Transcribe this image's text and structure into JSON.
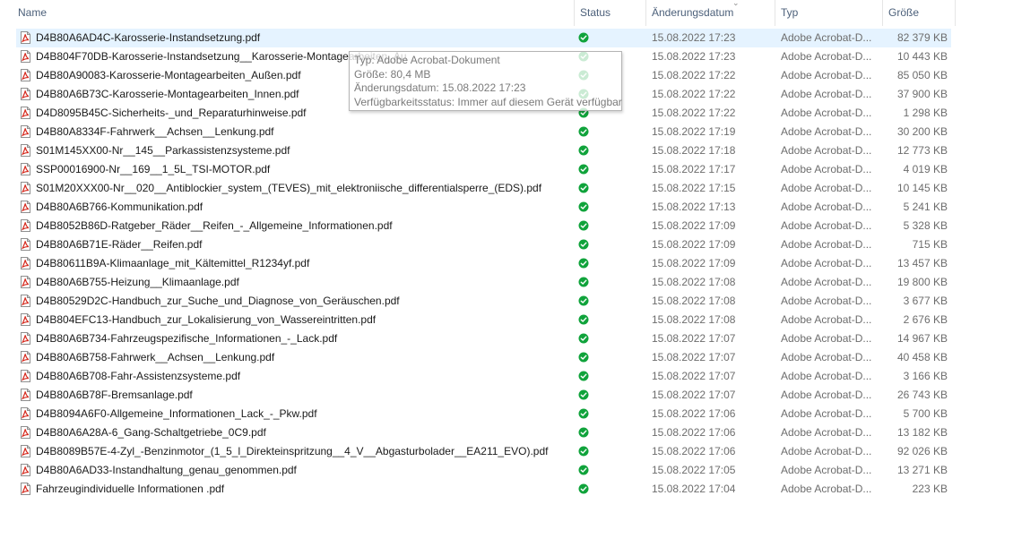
{
  "columns": {
    "name": "Name",
    "status": "Status",
    "date": "Änderungsdatum",
    "type": "Typ",
    "size": "Größe"
  },
  "icons": {
    "file": "pdf-file-icon",
    "status": "available-check-icon",
    "sort": "sort-chevron-icon",
    "pdf_color": "#d62b1f",
    "status_color": "#10a33b"
  },
  "files": [
    {
      "name": "D4B80A6AD4C-Karosserie-Instandsetzung.pdf",
      "date": "15.08.2022 17:23",
      "type": "Adobe Acrobat-D...",
      "size": "82 379 KB",
      "selected": true
    },
    {
      "name": "D4B804F70DB-Karosserie-Instandsetzung__Karosserie-Montagearbeiten_Au",
      "date": "15.08.2022 17:23",
      "type": "Adobe Acrobat-D...",
      "size": "10 443 KB"
    },
    {
      "name": "D4B80A90083-Karosserie-Montagearbeiten_Außen.pdf",
      "date": "15.08.2022 17:22",
      "type": "Adobe Acrobat-D...",
      "size": "85 050 KB"
    },
    {
      "name": "D4B80A6B73C-Karosserie-Montagearbeiten_Innen.pdf",
      "date": "15.08.2022 17:22",
      "type": "Adobe Acrobat-D...",
      "size": "37 900 KB"
    },
    {
      "name": "D4D8095B45C-Sicherheits-_und_Reparaturhinweise.pdf",
      "date": "15.08.2022 17:22",
      "type": "Adobe Acrobat-D...",
      "size": "1 298 KB"
    },
    {
      "name": "D4B80A8334F-Fahrwerk__Achsen__Lenkung.pdf",
      "date": "15.08.2022 17:19",
      "type": "Adobe Acrobat-D...",
      "size": "30 200 KB"
    },
    {
      "name": "S01M145XX00-Nr__145__Parkassistenzsysteme.pdf",
      "date": "15.08.2022 17:18",
      "type": "Adobe Acrobat-D...",
      "size": "12 773 KB"
    },
    {
      "name": "SSP00016900-Nr__169__1_5L_TSI-MOTOR.pdf",
      "date": "15.08.2022 17:17",
      "type": "Adobe Acrobat-D...",
      "size": "4 019 KB"
    },
    {
      "name": "S01M20XXX00-Nr__020__Antiblockier_system_(TEVES)_mit_elektroniische_differentialsperre_(EDS).pdf",
      "date": "15.08.2022 17:15",
      "type": "Adobe Acrobat-D...",
      "size": "10 145 KB"
    },
    {
      "name": "D4B80A6B766-Kommunikation.pdf",
      "date": "15.08.2022 17:13",
      "type": "Adobe Acrobat-D...",
      "size": "5 241 KB"
    },
    {
      "name": "D4B8052B86D-Ratgeber_Räder__Reifen_-_Allgemeine_Informationen.pdf",
      "date": "15.08.2022 17:09",
      "type": "Adobe Acrobat-D...",
      "size": "5 328 KB"
    },
    {
      "name": "D4B80A6B71E-Räder__Reifen.pdf",
      "date": "15.08.2022 17:09",
      "type": "Adobe Acrobat-D...",
      "size": "715 KB"
    },
    {
      "name": "D4B80611B9A-Klimaanlage_mit_Kältemittel_R1234yf.pdf",
      "date": "15.08.2022 17:09",
      "type": "Adobe Acrobat-D...",
      "size": "13 457 KB"
    },
    {
      "name": "D4B80A6B755-Heizung__Klimaanlage.pdf",
      "date": "15.08.2022 17:08",
      "type": "Adobe Acrobat-D...",
      "size": "19 800 KB"
    },
    {
      "name": "D4B80529D2C-Handbuch_zur_Suche_und_Diagnose_von_Geräuschen.pdf",
      "date": "15.08.2022 17:08",
      "type": "Adobe Acrobat-D...",
      "size": "3 677 KB"
    },
    {
      "name": "D4B804EFC13-Handbuch_zur_Lokalisierung_von_Wassereintritten.pdf",
      "date": "15.08.2022 17:08",
      "type": "Adobe Acrobat-D...",
      "size": "2 676 KB"
    },
    {
      "name": "D4B80A6B734-Fahrzeugspezifische_Informationen_-_Lack.pdf",
      "date": "15.08.2022 17:07",
      "type": "Adobe Acrobat-D...",
      "size": "14 967 KB"
    },
    {
      "name": "D4B80A6B758-Fahrwerk__Achsen__Lenkung.pdf",
      "date": "15.08.2022 17:07",
      "type": "Adobe Acrobat-D...",
      "size": "40 458 KB"
    },
    {
      "name": "D4B80A6B708-Fahr-Assistenzsysteme.pdf",
      "date": "15.08.2022 17:07",
      "type": "Adobe Acrobat-D...",
      "size": "3 166 KB"
    },
    {
      "name": "D4B80A6B78F-Bremsanlage.pdf",
      "date": "15.08.2022 17:07",
      "type": "Adobe Acrobat-D...",
      "size": "26 743 KB"
    },
    {
      "name": "D4B8094A6F0-Allgemeine_Informationen_Lack_-_Pkw.pdf",
      "date": "15.08.2022 17:06",
      "type": "Adobe Acrobat-D...",
      "size": "5 700 KB"
    },
    {
      "name": "D4B80A6A28A-6_Gang-Schaltgetriebe_0C9.pdf",
      "date": "15.08.2022 17:06",
      "type": "Adobe Acrobat-D...",
      "size": "13 182 KB"
    },
    {
      "name": "D4B8089B57E-4-Zyl_-Benzinmotor_(1_5_l_Direkteinspritzung__4_V__Abgasturbolader__EA211_EVO).pdf",
      "date": "15.08.2022 17:06",
      "type": "Adobe Acrobat-D...",
      "size": "92 026 KB"
    },
    {
      "name": "D4B80A6AD33-Instandhaltung_genau_genommen.pdf",
      "date": "15.08.2022 17:05",
      "type": "Adobe Acrobat-D...",
      "size": "13 271 KB"
    },
    {
      "name": "Fahrzeugindividuelle Informationen .pdf",
      "date": "15.08.2022 17:04",
      "type": "Adobe Acrobat-D...",
      "size": "223 KB"
    }
  ],
  "tooltip": {
    "type_line": "Typ: Adobe Acrobat-Dokument",
    "size_line": "Größe: 80,4 MB",
    "date_line": "Änderungsdatum: 15.08.2022 17:23",
    "status_line": "Verfügbarkeitsstatus: Immer auf diesem Gerät verfügbar"
  }
}
